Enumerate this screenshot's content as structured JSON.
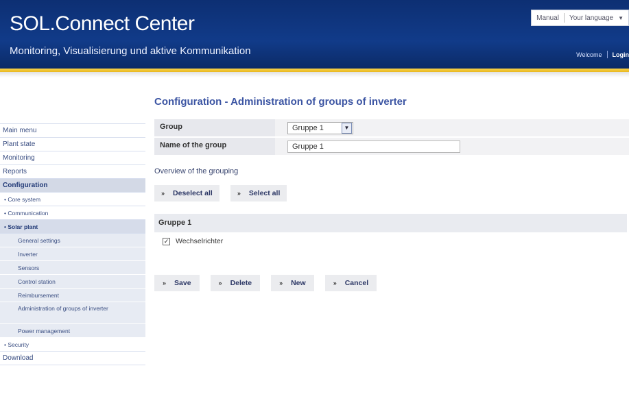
{
  "header": {
    "brand": "SOL.Connect Center",
    "tagline": "Monitoring, Visualisierung und aktive Kommunikation",
    "manual": "Manual",
    "language": "Your language",
    "welcome": "Welcome",
    "login": "Login"
  },
  "sidebar": {
    "items": [
      {
        "label": "Main menu"
      },
      {
        "label": "Plant state"
      },
      {
        "label": "Monitoring"
      },
      {
        "label": "Reports"
      },
      {
        "label": "Configuration"
      },
      {
        "label": "• Core system"
      },
      {
        "label": "• Communication"
      },
      {
        "label": "• Solar plant"
      },
      {
        "label": "General settings"
      },
      {
        "label": "Inverter"
      },
      {
        "label": "Sensors"
      },
      {
        "label": "Control station"
      },
      {
        "label": "Reimbursement"
      },
      {
        "label": "Administration of groups of inverter"
      },
      {
        "label": "Power management"
      },
      {
        "label": "• Security"
      },
      {
        "label": "Download"
      }
    ]
  },
  "main": {
    "title": "Configuration - Administration of groups of inverter",
    "group_label": "Group",
    "group_value": "Gruppe 1",
    "name_label": "Name of the group",
    "name_value": "Gruppe 1",
    "overview": "Overview of the grouping",
    "deselect": "Deselect all",
    "select": "Select all",
    "group_heading": "Gruppe 1",
    "checkbox_label": "Wechselrichter",
    "checkbox_checked": true,
    "save": "Save",
    "delete": "Delete",
    "new": "New",
    "cancel": "Cancel",
    "chevron": "»"
  },
  "colors": {
    "header_blue": "#113b89",
    "accent_gold": "#f2c535",
    "title_blue": "#3c55a3"
  }
}
